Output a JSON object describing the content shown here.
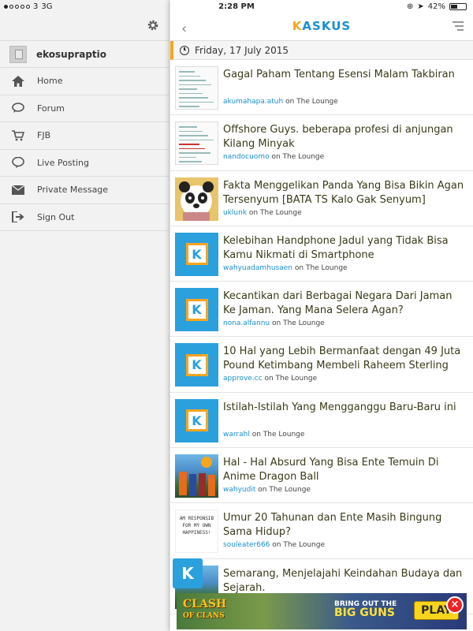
{
  "statusbar": {
    "carrier": "3",
    "network": "3G",
    "time": "2:28 PM",
    "battery": "42%",
    "battery_level": 0.42
  },
  "sidebar": {
    "user": {
      "name": "ekosupraptio"
    },
    "items": [
      {
        "label": "Home",
        "icon": "home-icon"
      },
      {
        "label": "Forum",
        "icon": "chat-bubble-icon"
      },
      {
        "label": "FJB",
        "icon": "cart-icon"
      },
      {
        "label": "Live Posting",
        "icon": "speech-bubble-icon"
      },
      {
        "label": "Private Message",
        "icon": "envelope-icon"
      },
      {
        "label": "Sign Out",
        "icon": "sign-out-icon"
      }
    ]
  },
  "header": {
    "logo": "KASKUS",
    "logo_first": "K",
    "logo_rest": "ASKUS"
  },
  "date": "Friday, 17 July 2015",
  "threads": [
    {
      "title": "Gagal Paham Tentang Esensi Malam Takbiran",
      "user": "akumahapa.atuh",
      "on": "on",
      "forum": "The Lounge",
      "thumb": "doc"
    },
    {
      "title": "Offshore Guys. beberapa profesi di anjungan Kilang Minyak",
      "user": "nandocuomo",
      "on": "on",
      "forum": "The Lounge",
      "thumb": "doc2"
    },
    {
      "title": "Fakta Menggelikan Panda Yang Bisa Bikin Agan Tersenyum [BATA TS Kalo Gak Senyum]",
      "user": "uklunk",
      "on": "on",
      "forum": "The Lounge",
      "thumb": "panda"
    },
    {
      "title": "Kelebihan Handphone Jadul yang Tidak Bisa Kamu Nikmati di Smartphone",
      "user": "wahyuadamhusaen",
      "on": "on",
      "forum": "The Lounge",
      "thumb": "kaskus"
    },
    {
      "title": "Kecantikan dari Berbagai Negara Dari Jaman Ke Jaman. Yang Mana Selera Agan?",
      "user": "nona.alfannu",
      "on": "on",
      "forum": "The Lounge",
      "thumb": "kaskus"
    },
    {
      "title": "10 Hal yang Lebih Bermanfaat dengan 49 Juta Pound Ketimbang Membeli Raheem Sterling",
      "user": "approve.cc",
      "on": "on",
      "forum": "The Lounge",
      "thumb": "kaskus"
    },
    {
      "title": "Istilah-Istilah Yang Mengganggu Baru-Baru ini",
      "user": "warrahl",
      "on": "on",
      "forum": "The Lounge",
      "thumb": "kaskus"
    },
    {
      "title": "Hal - Hal Absurd Yang Bisa Ente Temuin Di Anime Dragon Ball",
      "user": "wahyudit",
      "on": "on",
      "forum": "The Lounge",
      "thumb": "anime"
    },
    {
      "title": "Umur 20 Tahunan dan Ente Masih Bingung Sama Hidup?",
      "user": "souleater666",
      "on": "on",
      "forum": "The Lounge",
      "thumb": "text"
    },
    {
      "title": "Semarang, Menjelajahi Keindahan Budaya dan Sejarah.",
      "user": "",
      "on": "",
      "forum": "",
      "thumb": "photo"
    }
  ],
  "thumb_text": [
    "AM RESPONSIB",
    "FOR MY OWN",
    "HAPPINESS!"
  ],
  "fab_label": "K",
  "ad": {
    "brand_line1": "CLASH",
    "brand_line2": "OF CLANS",
    "slogan_line1": "BRING OUT THE",
    "slogan_line2": "BIG GUNS",
    "cta": "PLAY",
    "close": "×"
  },
  "colors": {
    "accent_blue": "#1a8fd1",
    "accent_orange": "#f7a51c"
  }
}
